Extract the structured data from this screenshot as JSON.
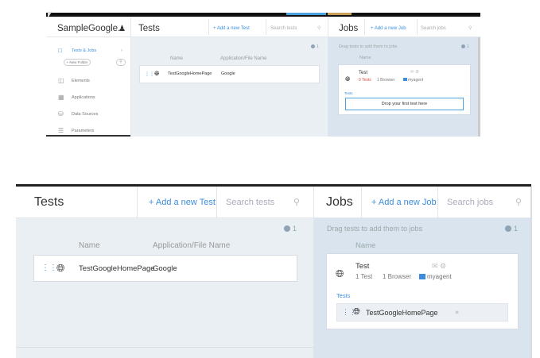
{
  "colors": {
    "accent": "#3b8ede",
    "panel_bg": "#eaeff4",
    "jobs_panel_bg": "#d9e4ee",
    "error": "#e04a3f"
  },
  "top": {
    "app_title": "SampleGoogle...",
    "tests_title": "Tests",
    "add_test": "+ Add a new Test",
    "search_tests_placeholder": "Search tests",
    "jobs_title": "Jobs",
    "add_job": "+ Add a new Job",
    "search_jobs_placeholder": "Search jobs",
    "nav": [
      {
        "label": "Tests & Jobs",
        "icon": "folder-icon"
      },
      {
        "label": "Elements",
        "icon": "elements-icon"
      },
      {
        "label": "Applications",
        "icon": "applications-icon"
      },
      {
        "label": "Data Sources",
        "icon": "database-icon"
      },
      {
        "label": "Parameters",
        "icon": "sliders-icon"
      }
    ],
    "new_folder": "+ New Folder",
    "tests_count": "1",
    "columns": {
      "name": "Name",
      "app": "Application/File Name"
    },
    "test_row": {
      "name": "TestGoogleHomePage",
      "app": "Google"
    },
    "drag_hint": "Drag tests to add them to jobs",
    "jobs_count": "1",
    "job_col_name": "Name",
    "job": {
      "title": "Test",
      "tests": "0 Tests",
      "browsers": "1 Browser",
      "agent": "myagent",
      "tests_label": "Tests",
      "drop_hint": "Drop your first test here"
    }
  },
  "bottom": {
    "tests_title": "Tests",
    "add_test": "+ Add a new Test",
    "search_tests_placeholder": "Search tests",
    "jobs_title": "Jobs",
    "add_job": "+ Add a new Job",
    "search_jobs_placeholder": "Search jobs",
    "tests_count": "1",
    "columns": {
      "name": "Name",
      "app": "Application/File Name"
    },
    "test_row": {
      "name": "TestGoogleHomePage",
      "app": "Google"
    },
    "drag_hint": "Drag tests to add them to jobs",
    "jobs_count": "1",
    "job_col_name": "Name",
    "job": {
      "title": "Test",
      "tests": "1 Test",
      "browsers": "1 Browser",
      "agent": "myagent",
      "tests_label": "Tests",
      "assigned_test": "TestGoogleHomePage"
    }
  }
}
